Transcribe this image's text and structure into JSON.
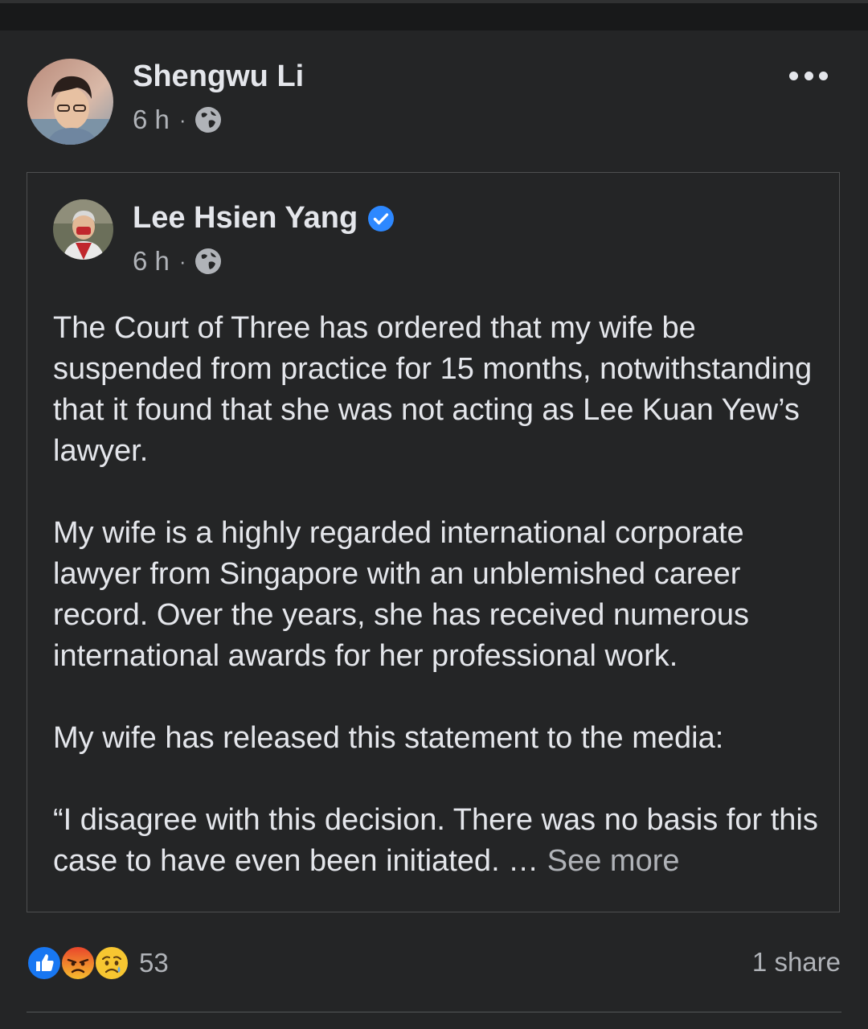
{
  "post": {
    "author": {
      "name": "Shengwu Li",
      "time": "6 h",
      "separator": "·",
      "audience_icon": "globe-icon"
    },
    "more_icon": "more-horizontal-icon",
    "shared": {
      "author": {
        "name": "Lee Hsien Yang",
        "verified_icon": "verified-badge-icon",
        "time": "6 h",
        "separator": "·",
        "audience_icon": "globe-icon"
      },
      "paragraphs": [
        "The Court of Three has ordered that my wife be suspended from practice for 15 months, notwithstanding that it found that she was not acting as Lee Kuan Yew’s lawyer.",
        "My wife is a highly regarded international corporate lawyer from Singapore with an unblemished career record.  Over the years, she has received numerous international awards for her professional work.",
        "My wife has released this statement to the media:",
        "“I disagree with this decision. There was no basis for this case to have even been initiated. …"
      ],
      "see_more": "See more"
    },
    "reactions": {
      "icons": [
        "like-icon",
        "angry-icon",
        "sad-icon"
      ],
      "count": "53"
    },
    "shares": "1 share"
  },
  "colors": {
    "background": "#242526",
    "text": "#e4e6eb",
    "secondary": "#b0b3b8",
    "like_blue": "#1877f2",
    "verified": "#2d88ff"
  }
}
